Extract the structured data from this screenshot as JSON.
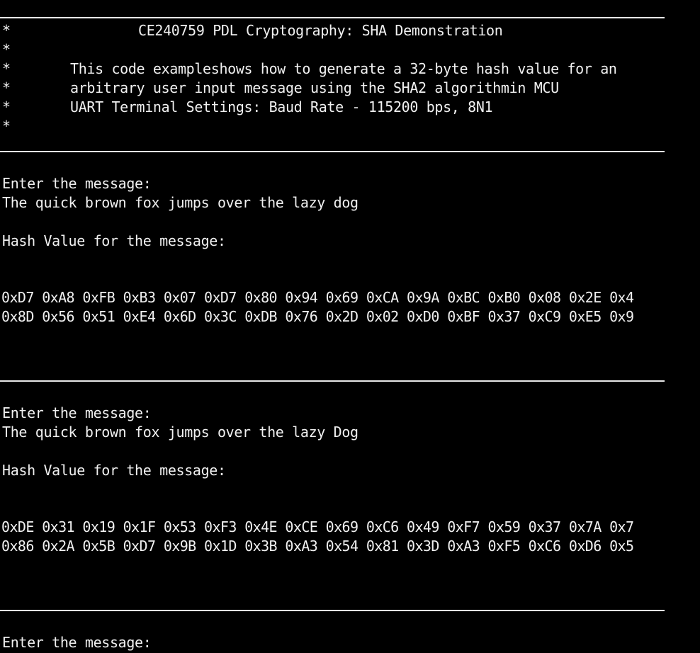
{
  "app": {
    "accent_color": "#e8e8e8",
    "background_color": "#000000",
    "text_color": "#f0f0f0"
  },
  "banner": {
    "title": "CE240759 PDL Cryptography: SHA Demonstration",
    "star": "*",
    "description_line_1": "This code exampleshows how to generate a 32-byte hash value for an",
    "description_line_2": "arbitrary user input message using the SHA2 algorithmin MCU",
    "description_line_3": "UART Terminal Settings: Baud Rate - 115200 bps, 8N1"
  },
  "sessions": [
    {
      "prompt": "Enter the message:",
      "message": "The quick brown fox jumps over the lazy dog",
      "hash_label": "Hash Value for the message:",
      "hash_line_1": "0xD7 0xA8 0xFB 0xB3 0x07 0xD7 0x80 0x94 0x69 0xCA 0x9A 0xBC 0xB0 0x08 0x2E 0x4",
      "hash_line_2": "0x8D 0x56 0x51 0xE4 0x6D 0x3C 0xDB 0x76 0x2D 0x02 0xD0 0xBF 0x37 0xC9 0xE5 0x9"
    },
    {
      "prompt": "Enter the message:",
      "message": "The quick brown fox jumps over the lazy Dog",
      "hash_label": "Hash Value for the message:",
      "hash_line_1": "0xDE 0x31 0x19 0x1F 0x53 0xF3 0x4E 0xCE 0x69 0xC6 0x49 0xF7 0x59 0x37 0x7A 0x7",
      "hash_line_2": "0x86 0x2A 0x5B 0xD7 0x9B 0x1D 0x3B 0xA3 0x54 0x81 0x3D 0xA3 0xF5 0xC6 0xD6 0x5"
    },
    {
      "prompt": "Enter the message:"
    }
  ]
}
